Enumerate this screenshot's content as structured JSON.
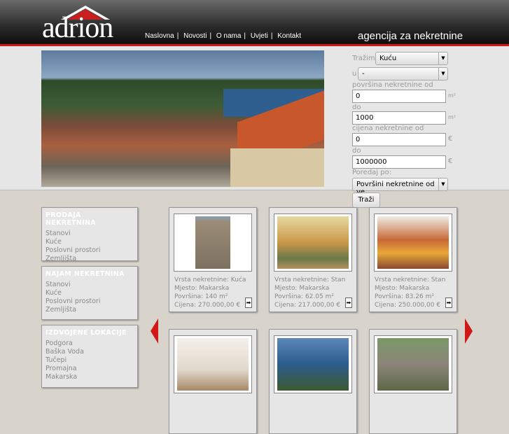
{
  "header": {
    "logo": "adrion",
    "tagline": "agencija za nekretnine",
    "nav": [
      "Naslovna",
      "Novosti",
      "O nama",
      "Uvjeti",
      "Kontakt"
    ]
  },
  "search": {
    "trazim_label": "Tražim",
    "trazim_value": "Kuću",
    "u_label": "u",
    "u_value": "-",
    "povrsina_od_label": "površina nekretnine od",
    "povrsina_od": "0",
    "povrsina_do_label": "do",
    "povrsina_do": "1000",
    "area_unit": "m²",
    "cijena_od_label": "cijena nekretnine od",
    "cijena_od": "0",
    "cijena_do_label": "do",
    "cijena_do": "1000000",
    "price_unit": "€",
    "sort_label": "Poredaj po:",
    "sort_value": "Površini nekretnine od ve",
    "submit": "Traži"
  },
  "sidebar": [
    {
      "title": "PRODAJA NEKRETNINA",
      "items": [
        "Stanovi",
        "Kuće",
        "Poslovni prostori",
        "Zemljišta"
      ]
    },
    {
      "title": "NAJAM NEKRETNINA",
      "items": [
        "Stanovi",
        "Kuće",
        "Poslovni prostori",
        "Zemljišta"
      ]
    },
    {
      "title": "IZDVOJENE LOKACIJE",
      "items": [
        "Podgora",
        "Baška Voda",
        "Tučepi",
        "Promajna",
        "Makarska"
      ]
    }
  ],
  "listings": [
    {
      "type": "Vrsta nekretnine: Kuća",
      "place": "Mjesto: Makarska",
      "area": "Površina: 140 m²",
      "price": "Cijena: 270.000,00 €"
    },
    {
      "type": "Vrsta nekretnine: Stan",
      "place": "Mjesto: Makarska",
      "area": "Površina: 62.05 m²",
      "price": "Cijena: 217.000,00 €"
    },
    {
      "type": "Vrsta nekretnine: Stan",
      "place": "Mjesto: Makarska",
      "area": "Površina: 83.26 m²",
      "price": "Cijena: 250.000,00 €"
    }
  ],
  "colors": {
    "accent": "#d01818",
    "panel": "#e6e6e6"
  }
}
